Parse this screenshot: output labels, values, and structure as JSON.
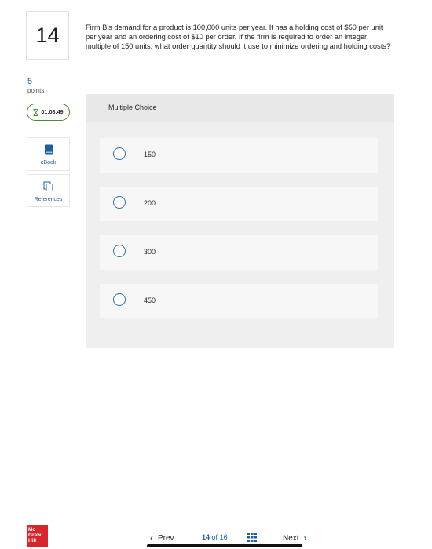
{
  "question": {
    "number": "14",
    "text": "Firm B's demand for a product is 100,000 units per year. It has a holding cost of $50 per unit per year and an ordering cost of $10 per order. If the firm is required to order an integer multiple of 150 units, what order quantity should it use to minimize ordering and holding costs?",
    "points_value": "5",
    "points_label": "points"
  },
  "timer": {
    "value": "01:08:49",
    "icon": "hourglass-icon",
    "color": "#4d8a33"
  },
  "sidebar": {
    "ebook_label": "eBook",
    "references_label": "References"
  },
  "multiple_choice": {
    "title": "Multiple Choice",
    "options": [
      {
        "label": "150"
      },
      {
        "label": "200"
      },
      {
        "label": "300"
      },
      {
        "label": "450"
      }
    ]
  },
  "footer": {
    "logo_lines": [
      "Mc",
      "Graw",
      "Hill"
    ],
    "logo_color": "#d8262c",
    "prev_label": "Prev",
    "current_page": "14",
    "of_label": "of",
    "total_pages": "16",
    "next_label": "Next"
  },
  "colors": {
    "accent": "#1f5f9e",
    "radio": "#2a6fb0"
  }
}
